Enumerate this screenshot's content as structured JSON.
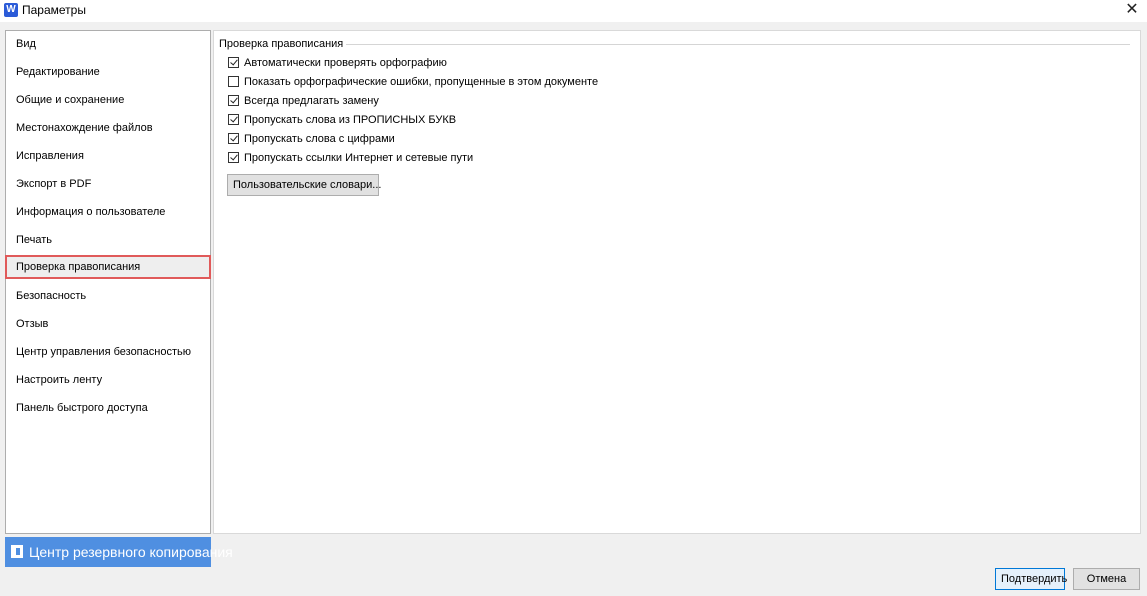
{
  "window": {
    "app_icon_letter": "W",
    "title": "Параметры",
    "close_glyph": "✕"
  },
  "sidebar": {
    "items": [
      {
        "label": "Вид"
      },
      {
        "label": "Редактирование"
      },
      {
        "label": "Общие и сохранение"
      },
      {
        "label": "Местонахождение файлов"
      },
      {
        "label": "Исправления"
      },
      {
        "label": "Экспорт в PDF"
      },
      {
        "label": "Информация о пользователе"
      },
      {
        "label": "Печать"
      },
      {
        "label": "Проверка правописания",
        "selected": true
      },
      {
        "label": "Безопасность"
      },
      {
        "label": "Отзыв"
      },
      {
        "label": "Центр управления безопасностью"
      },
      {
        "label": "Настроить ленту"
      },
      {
        "label": "Панель быстрого доступа"
      }
    ],
    "backup": {
      "label": "Центр резервного копирования",
      "icon": "document-icon"
    }
  },
  "spelling": {
    "group_title": "Проверка правописания",
    "options": [
      {
        "label": "Автоматически проверять орфографию",
        "checked": true
      },
      {
        "label": "Показать орфографические ошибки, пропущенные в этом документе",
        "checked": false
      },
      {
        "label": "Всегда предлагать замену",
        "checked": true
      },
      {
        "label": "Пропускать слова из ПРОПИСНЫХ БУКВ",
        "checked": true
      },
      {
        "label": "Пропускать слова с цифрами",
        "checked": true
      },
      {
        "label": "Пропускать ссылки Интернет и сетевые пути",
        "checked": true
      }
    ],
    "custom_dict_button": "Пользовательские словари..."
  },
  "footer": {
    "confirm_label": "Подтвердить",
    "cancel_label": "Отмена"
  },
  "colors": {
    "accent": "#4f8fe1",
    "selection_outline": "#e05a5a",
    "primary_button_border": "#0078d7"
  }
}
